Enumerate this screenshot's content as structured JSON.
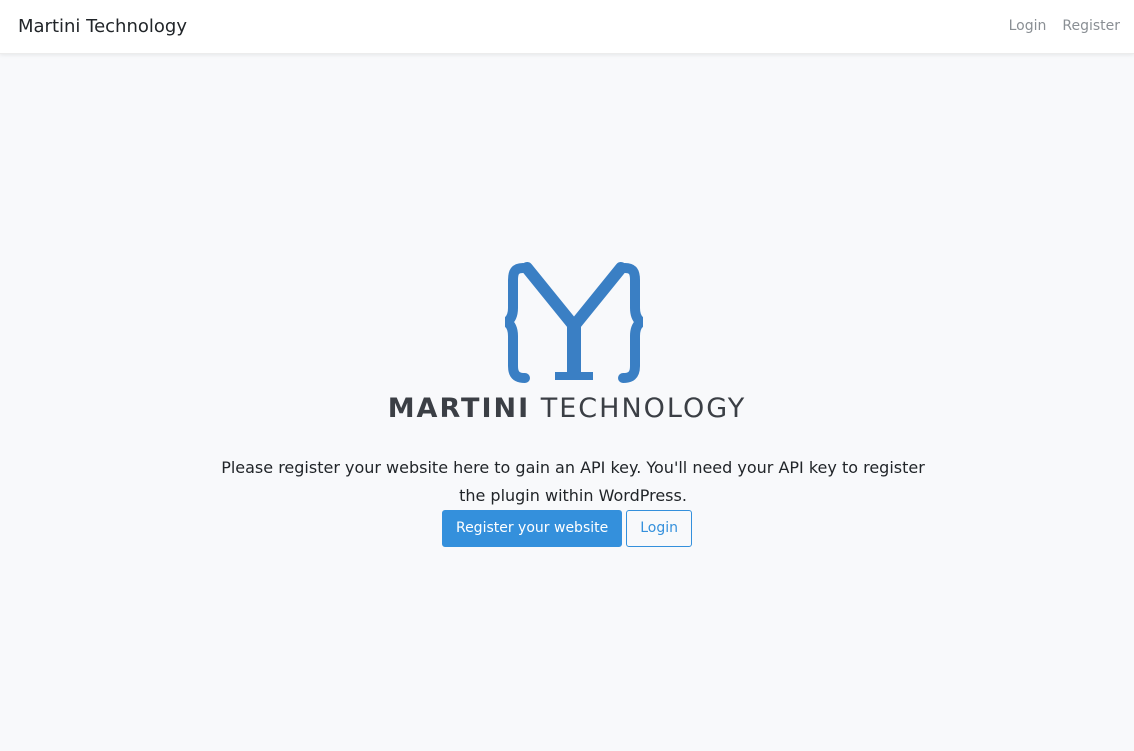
{
  "navbar": {
    "brand": "Martini Technology",
    "links": [
      {
        "label": "Login"
      },
      {
        "label": "Register"
      }
    ]
  },
  "hero": {
    "logo_icon": "martini-logo-icon",
    "wordmark_bold": "MARTINI",
    "wordmark_light": "TECHNOLOGY",
    "lead": "Please register your website here to gain an API key. You'll need your API key to register the plugin within WordPress.",
    "primary_button": "Register your website",
    "secondary_button": "Login"
  },
  "colors": {
    "brand_blue": "#3490dc",
    "logo_blue": "#3a7fc4",
    "background": "#f8f9fb",
    "text_dark": "#212529",
    "nav_link": "#8a8f94"
  }
}
